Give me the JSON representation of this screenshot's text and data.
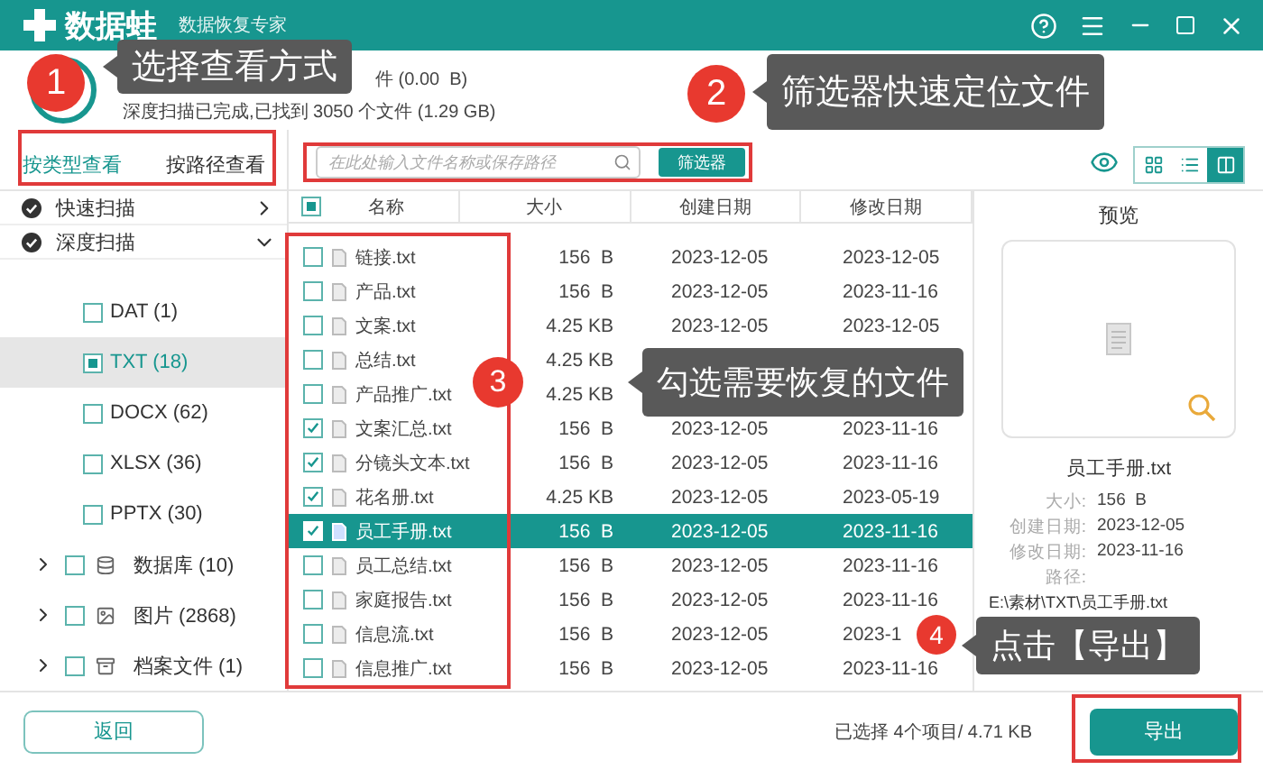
{
  "app": {
    "name": "数据蛙",
    "subtitle": "数据恢复专家"
  },
  "scan_status": {
    "quick": "件 (0.00  B)",
    "deep": "深度扫描已完成,已找到 3050 个文件 (1.29 GB)"
  },
  "view_tabs": [
    {
      "label": "按类型查看",
      "selected": true
    },
    {
      "label": "按路径查看",
      "selected": false
    }
  ],
  "search": {
    "placeholder": "在此处输入文件名称或保存路径"
  },
  "filter_button": "筛选器",
  "view_modes": [
    {
      "kind": "grid",
      "selected": false
    },
    {
      "kind": "list",
      "selected": false
    },
    {
      "kind": "detail",
      "selected": true
    }
  ],
  "sidebar": {
    "scans": [
      {
        "label": "快速扫描",
        "expanded": false
      },
      {
        "label": "深度扫描",
        "expanded": true
      }
    ],
    "types": [
      {
        "label": "DAT (1)",
        "checked": false,
        "selected": false
      },
      {
        "label": "TXT (18)",
        "checked": true,
        "selected": true
      },
      {
        "label": "DOCX (62)",
        "checked": false,
        "selected": false
      },
      {
        "label": "XLSX (36)",
        "checked": false,
        "selected": false
      },
      {
        "label": "PPTX (30)",
        "checked": false,
        "selected": false
      }
    ],
    "categories": [
      {
        "label": "数据库 (10)",
        "kind": "database",
        "checked": false
      },
      {
        "label": "图片 (2868)",
        "kind": "image",
        "checked": false
      },
      {
        "label": "档案文件 (1)",
        "kind": "archive",
        "checked": false
      }
    ]
  },
  "table": {
    "columns": [
      "名称",
      "大小",
      "创建日期",
      "修改日期"
    ],
    "select_all_partial": true,
    "rows": [
      {
        "name": "链接.txt",
        "size": "156  B",
        "created": "2023-12-05",
        "modified": "2023-12-05",
        "checked": false,
        "selected": false
      },
      {
        "name": "产品.txt",
        "size": "156  B",
        "created": "2023-12-05",
        "modified": "2023-11-16",
        "checked": false,
        "selected": false
      },
      {
        "name": "文案.txt",
        "size": "4.25 KB",
        "created": "2023-12-05",
        "modified": "2023-12-05",
        "checked": false,
        "selected": false
      },
      {
        "name": "总结.txt",
        "size": "4.25 KB",
        "checked": false,
        "selected": false
      },
      {
        "name": "产品推广.txt",
        "size": "4.25 KB",
        "checked": false,
        "selected": false
      },
      {
        "name": "文案汇总.txt",
        "size": "156  B",
        "created": "2023-12-05",
        "modified": "2023-11-16",
        "checked": true,
        "selected": false
      },
      {
        "name": "分镜头文本.txt",
        "size": "156  B",
        "created": "2023-12-05",
        "modified": "2023-11-16",
        "checked": true,
        "selected": false
      },
      {
        "name": "花名册.txt",
        "size": "4.25 KB",
        "created": "2023-12-05",
        "modified": "2023-05-19",
        "checked": true,
        "selected": false
      },
      {
        "name": "员工手册.txt",
        "size": "156  B",
        "created": "2023-12-05",
        "modified": "2023-11-16",
        "checked": true,
        "selected": true
      },
      {
        "name": "员工总结.txt",
        "size": "156  B",
        "created": "2023-12-05",
        "modified": "2023-11-16",
        "checked": false,
        "selected": false
      },
      {
        "name": "家庭报告.txt",
        "size": "156  B",
        "created": "2023-12-05",
        "modified": "2023-11-16",
        "checked": false,
        "selected": false
      },
      {
        "name": "信息流.txt",
        "size": "156  B",
        "created": "2023-12-05",
        "modified": "2023-1",
        "checked": false,
        "selected": false
      },
      {
        "name": "信息推广.txt",
        "size": "156  B",
        "created": "2023-12-05",
        "modified": "2023-11-16",
        "checked": false,
        "selected": false
      }
    ]
  },
  "preview": {
    "title": "预览",
    "file": "员工手册.txt",
    "fields": [
      {
        "label": "大小:",
        "value": "156  B"
      },
      {
        "label": "创建日期:",
        "value": "2023-12-05"
      },
      {
        "label": "修改日期:",
        "value": "2023-11-16"
      },
      {
        "label": "路径:"
      }
    ],
    "path": "E:\\素材\\TXT\\员工手册.txt"
  },
  "footer": {
    "back": "返回",
    "summary": "已选择 4个项目/ 4.71 KB",
    "export": "导出"
  },
  "annotations": [
    {
      "number": "1",
      "text": "选择查看方式"
    },
    {
      "number": "2",
      "text": "筛选器快速定位文件"
    },
    {
      "number": "3",
      "text": "勾选需要恢复的文件"
    },
    {
      "number": "4",
      "text": "点击【导出】"
    }
  ]
}
